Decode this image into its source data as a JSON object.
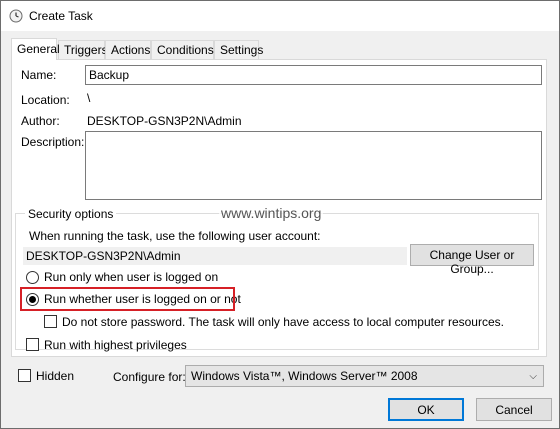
{
  "window": {
    "title": "Create Task",
    "icon": "clock-icon"
  },
  "tabs": [
    {
      "label": "General",
      "active": true
    },
    {
      "label": "Triggers",
      "active": false
    },
    {
      "label": "Actions",
      "active": false
    },
    {
      "label": "Conditions",
      "active": false
    },
    {
      "label": "Settings",
      "active": false
    }
  ],
  "general": {
    "name_label": "Name:",
    "name_value": "Backup",
    "location_label": "Location:",
    "location_value": "\\",
    "author_label": "Author:",
    "author_value": "DESKTOP-GSN3P2N\\Admin",
    "description_label": "Description:",
    "description_value": ""
  },
  "security": {
    "group_title": "Security options",
    "account_prompt": "When running the task, use the following user account:",
    "account_value": "DESKTOP-GSN3P2N\\Admin",
    "change_user_button": "Change User or Group...",
    "radio_logged_on": "Run only when user is logged on",
    "radio_logged_on_checked": false,
    "radio_whether": "Run whether user is logged on or not",
    "radio_whether_checked": true,
    "no_store_password": "Do not store password.  The task will only have access to local computer resources.",
    "no_store_password_checked": false,
    "highest_privileges": "Run with highest privileges",
    "highest_privileges_checked": false,
    "highlight_color": "#d62026"
  },
  "watermark": "www.wintips.org",
  "footer": {
    "hidden_label": "Hidden",
    "hidden_checked": false,
    "configure_label": "Configure for:",
    "configure_value": "Windows Vista™, Windows Server™ 2008",
    "ok_button": "OK",
    "cancel_button": "Cancel"
  }
}
